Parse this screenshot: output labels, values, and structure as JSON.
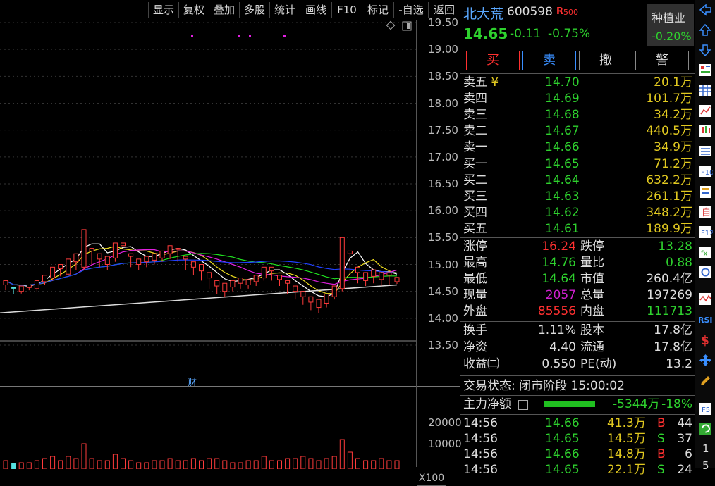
{
  "toolbar": {
    "items": [
      "显示",
      "复权",
      "叠加",
      "多股",
      "统计",
      "画线",
      "F10",
      "标记",
      "-自选",
      "返回"
    ]
  },
  "stock": {
    "name": "北大荒",
    "code": "600598",
    "badge_r": "R",
    "badge_500": "500",
    "price": "14.65",
    "change": "-0.11",
    "change_pct": "-0.75%",
    "sector_name": "种植业",
    "sector_pct": "-0.20%"
  },
  "trade_buttons": [
    "买",
    "卖",
    "撤",
    "警"
  ],
  "sell_book": [
    {
      "label": "卖五",
      "marker": "¥",
      "price": "14.70",
      "vol": "20.1万"
    },
    {
      "label": "卖四",
      "marker": "",
      "price": "14.69",
      "vol": "101.7万"
    },
    {
      "label": "卖三",
      "marker": "",
      "price": "14.68",
      "vol": "34.2万"
    },
    {
      "label": "卖二",
      "marker": "",
      "price": "14.67",
      "vol": "440.5万"
    },
    {
      "label": "卖一",
      "marker": "",
      "price": "14.66",
      "vol": "34.9万"
    }
  ],
  "buy_book": [
    {
      "label": "买一",
      "price": "14.65",
      "vol": "71.2万"
    },
    {
      "label": "买二",
      "price": "14.64",
      "vol": "632.2万"
    },
    {
      "label": "买三",
      "price": "14.63",
      "vol": "261.1万"
    },
    {
      "label": "买四",
      "price": "14.62",
      "vol": "348.2万"
    },
    {
      "label": "买五",
      "price": "14.61",
      "vol": "189.9万"
    }
  ],
  "quote": {
    "limit_up_label": "涨停",
    "limit_up": "16.24",
    "limit_down_label": "跌停",
    "limit_down": "13.28",
    "high_label": "最高",
    "high": "14.76",
    "vol_ratio_label": "量比",
    "vol_ratio": "0.88",
    "low_label": "最低",
    "low": "14.64",
    "mktcap_label": "市值",
    "mktcap": "260.4亿",
    "cur_vol_label": "现量",
    "cur_vol": "2057",
    "total_vol_label": "总量",
    "total_vol": "197269",
    "outer_label": "外盘",
    "outer": "85556",
    "inner_label": "内盘",
    "inner": "111713",
    "turnover_label": "换手",
    "turnover": "1.11%",
    "shares_label": "股本",
    "shares": "17.8亿",
    "nav_label": "净资",
    "nav": "4.40",
    "float_label": "流通",
    "float": "17.8亿",
    "eps_label": "收益㈡",
    "eps": "0.550",
    "pe_label": "PE(动)",
    "pe": "13.2"
  },
  "status": {
    "label": "交易状态:",
    "value": "闭市阶段",
    "time": "15:00:02"
  },
  "main_flow": {
    "label": "主力净额",
    "value": "-5344万",
    "pct": "-18%",
    "bar_fraction": 0.18
  },
  "ticks": [
    {
      "time": "14:56",
      "price": "14.66",
      "vol": "41.3万",
      "side": "B",
      "count": "44"
    },
    {
      "time": "14:56",
      "price": "14.65",
      "vol": "14.5万",
      "side": "S",
      "count": "37"
    },
    {
      "time": "14:56",
      "price": "14.66",
      "vol": "14.8万",
      "side": "B",
      "count": "6"
    },
    {
      "time": "14:56",
      "price": "14.65",
      "vol": "22.1万",
      "side": "S",
      "count": "24"
    }
  ],
  "finance_marker": "财",
  "volume_unit": "X100",
  "chart_data": {
    "type": "candlestick",
    "y_ticks": [
      "19.50",
      "19.00",
      "18.50",
      "18.00",
      "17.50",
      "17.00",
      "16.50",
      "16.00",
      "15.50",
      "15.00",
      "14.50",
      "14.00",
      "13.50"
    ],
    "ylim": [
      13.2,
      19.9
    ],
    "volume_ticks": [
      "20000",
      "10000"
    ],
    "candles": [
      [
        14.62,
        14.7,
        14.52,
        14.58
      ],
      [
        14.58,
        14.55,
        14.45,
        14.5
      ],
      [
        14.5,
        14.6,
        14.46,
        14.57
      ],
      [
        14.57,
        14.62,
        14.52,
        14.55
      ],
      [
        14.55,
        14.7,
        14.5,
        14.68
      ],
      [
        14.68,
        14.8,
        14.62,
        14.75
      ],
      [
        14.75,
        14.95,
        14.7,
        14.92
      ],
      [
        14.92,
        15.0,
        14.78,
        14.82
      ],
      [
        14.82,
        15.1,
        14.8,
        15.05
      ],
      [
        15.05,
        15.2,
        14.9,
        14.95
      ],
      [
        14.95,
        15.65,
        14.9,
        15.25
      ],
      [
        15.25,
        15.3,
        15.0,
        15.1
      ],
      [
        15.1,
        15.2,
        14.95,
        15.0
      ],
      [
        15.0,
        15.15,
        14.9,
        15.12
      ],
      [
        15.12,
        15.4,
        15.05,
        15.35
      ],
      [
        15.35,
        15.4,
        15.1,
        15.15
      ],
      [
        15.15,
        15.2,
        14.95,
        15.0
      ],
      [
        15.0,
        15.1,
        14.9,
        15.05
      ],
      [
        15.05,
        15.15,
        14.95,
        15.08
      ],
      [
        15.08,
        15.2,
        15.0,
        15.12
      ],
      [
        15.12,
        15.25,
        15.05,
        15.2
      ],
      [
        15.2,
        15.35,
        15.1,
        15.28
      ],
      [
        15.28,
        15.3,
        15.05,
        15.1
      ],
      [
        15.1,
        15.15,
        14.9,
        14.95
      ],
      [
        14.95,
        15.05,
        14.8,
        14.88
      ],
      [
        14.88,
        15.0,
        14.7,
        14.75
      ],
      [
        14.75,
        14.85,
        14.55,
        14.6
      ],
      [
        14.6,
        14.7,
        14.45,
        14.5
      ],
      [
        14.5,
        14.65,
        14.4,
        14.58
      ],
      [
        14.58,
        14.7,
        14.5,
        14.65
      ],
      [
        14.65,
        14.75,
        14.55,
        14.62
      ],
      [
        14.62,
        14.72,
        14.55,
        14.68
      ],
      [
        14.68,
        14.8,
        14.6,
        14.75
      ],
      [
        14.75,
        14.95,
        14.7,
        14.88
      ],
      [
        14.88,
        14.95,
        14.7,
        14.72
      ],
      [
        14.72,
        14.8,
        14.6,
        14.65
      ],
      [
        14.65,
        14.7,
        14.45,
        14.5
      ],
      [
        14.5,
        14.6,
        14.35,
        14.4
      ],
      [
        14.4,
        14.5,
        14.25,
        14.3
      ],
      [
        14.3,
        14.4,
        14.15,
        14.2
      ],
      [
        14.2,
        14.35,
        14.1,
        14.28
      ],
      [
        14.28,
        14.45,
        14.2,
        14.4
      ],
      [
        14.4,
        14.6,
        14.35,
        14.55
      ],
      [
        14.55,
        15.5,
        14.5,
        15.2
      ],
      [
        15.2,
        15.25,
        14.8,
        14.85
      ],
      [
        14.85,
        14.95,
        14.65,
        14.7
      ],
      [
        14.7,
        14.85,
        14.6,
        14.78
      ],
      [
        14.78,
        14.9,
        14.65,
        14.72
      ],
      [
        14.72,
        14.85,
        14.6,
        14.8
      ],
      [
        14.8,
        14.85,
        14.62,
        14.68
      ],
      [
        14.68,
        14.76,
        14.64,
        14.65
      ]
    ],
    "volumes": [
      4,
      3,
      3,
      3,
      4,
      5,
      6,
      4,
      6,
      5,
      12,
      5,
      4,
      4,
      7,
      5,
      4,
      3,
      3,
      4,
      4,
      5,
      4,
      4,
      5,
      4,
      5,
      5,
      4,
      3,
      3,
      4,
      4,
      6,
      4,
      4,
      5,
      5,
      6,
      5,
      4,
      5,
      6,
      14,
      8,
      5,
      4,
      4,
      5,
      4,
      4
    ]
  }
}
